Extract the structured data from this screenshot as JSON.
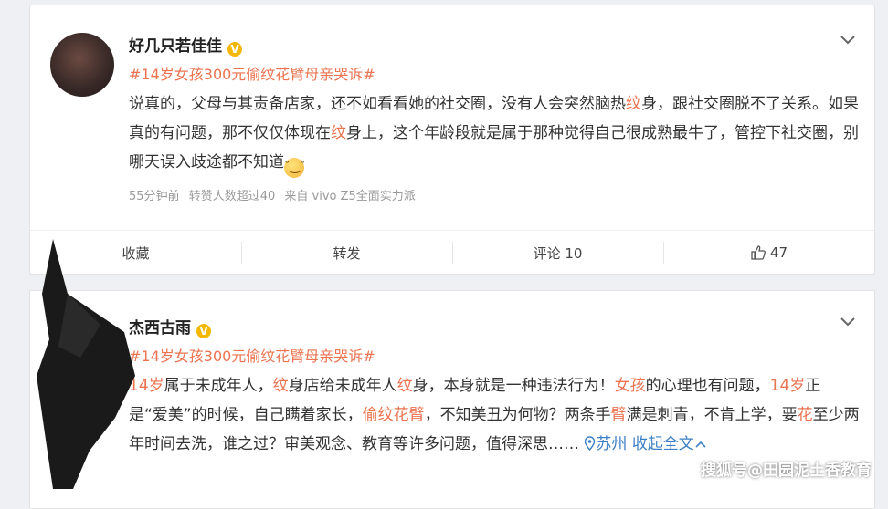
{
  "posts": [
    {
      "username": "好几只若佳佳",
      "verified_badge": "V",
      "hashtag": "#14岁女孩300元偷纹花臂母亲哭诉#",
      "text": [
        {
          "t": "说真的，父母与其责备店家，还不如看看她的社交圈，没有人会突然脑热",
          "hl": false
        },
        {
          "t": "纹",
          "hl": true
        },
        {
          "t": "身，跟社交圈脱不了关系。如果真的有问题，那不仅仅体现在",
          "hl": false
        },
        {
          "t": "纹",
          "hl": true
        },
        {
          "t": "身上，这个年龄段就是属于那种觉得自己很成熟最牛了，管控下社交圈，别哪天误入歧途都不知道",
          "hl": false
        }
      ],
      "emoji_icon": "smirk-emoji-icon",
      "meta": {
        "time": "55分钟前",
        "reposts": "转赞人数超过40",
        "source": "来自 vivo Z5全面实力派"
      },
      "actions": {
        "favorite": "收藏",
        "repost": "转发",
        "comment": "评论 10",
        "like_count": "47"
      }
    },
    {
      "username": "杰西古雨",
      "verified_badge": "V",
      "hashtag": "#14岁女孩300元偷纹花臂母亲哭诉#",
      "text": [
        {
          "t": "14岁",
          "hl": true
        },
        {
          "t": "属于未成年人，",
          "hl": false
        },
        {
          "t": "纹",
          "hl": true
        },
        {
          "t": "身店给未成年人",
          "hl": false
        },
        {
          "t": "纹",
          "hl": true
        },
        {
          "t": "身，本身就是一种违法行为！",
          "hl": false
        },
        {
          "t": "女孩",
          "hl": true
        },
        {
          "t": "的心理也有问题，",
          "hl": false
        },
        {
          "t": "14岁",
          "hl": true
        },
        {
          "t": "正是“爱美”的时候，自己瞒着家长，",
          "hl": false
        },
        {
          "t": "偷纹花臂",
          "hl": true
        },
        {
          "t": "，不知美丑为何物？两条手",
          "hl": false
        },
        {
          "t": "臂",
          "hl": true
        },
        {
          "t": "满是刺青，不肯上学，要",
          "hl": false
        },
        {
          "t": "花",
          "hl": true
        },
        {
          "t": "至少两年时间去洗，谁之过？审美观念、教育等许多问题，值得深思……",
          "hl": false
        }
      ],
      "location": "苏州",
      "collapse_link": "收起全文"
    }
  ],
  "watermark": "搜狐号@田园泥土香教育",
  "colors": {
    "accent": "#eb7350",
    "link": "#3b7fc4",
    "badge": "#f5b800"
  }
}
